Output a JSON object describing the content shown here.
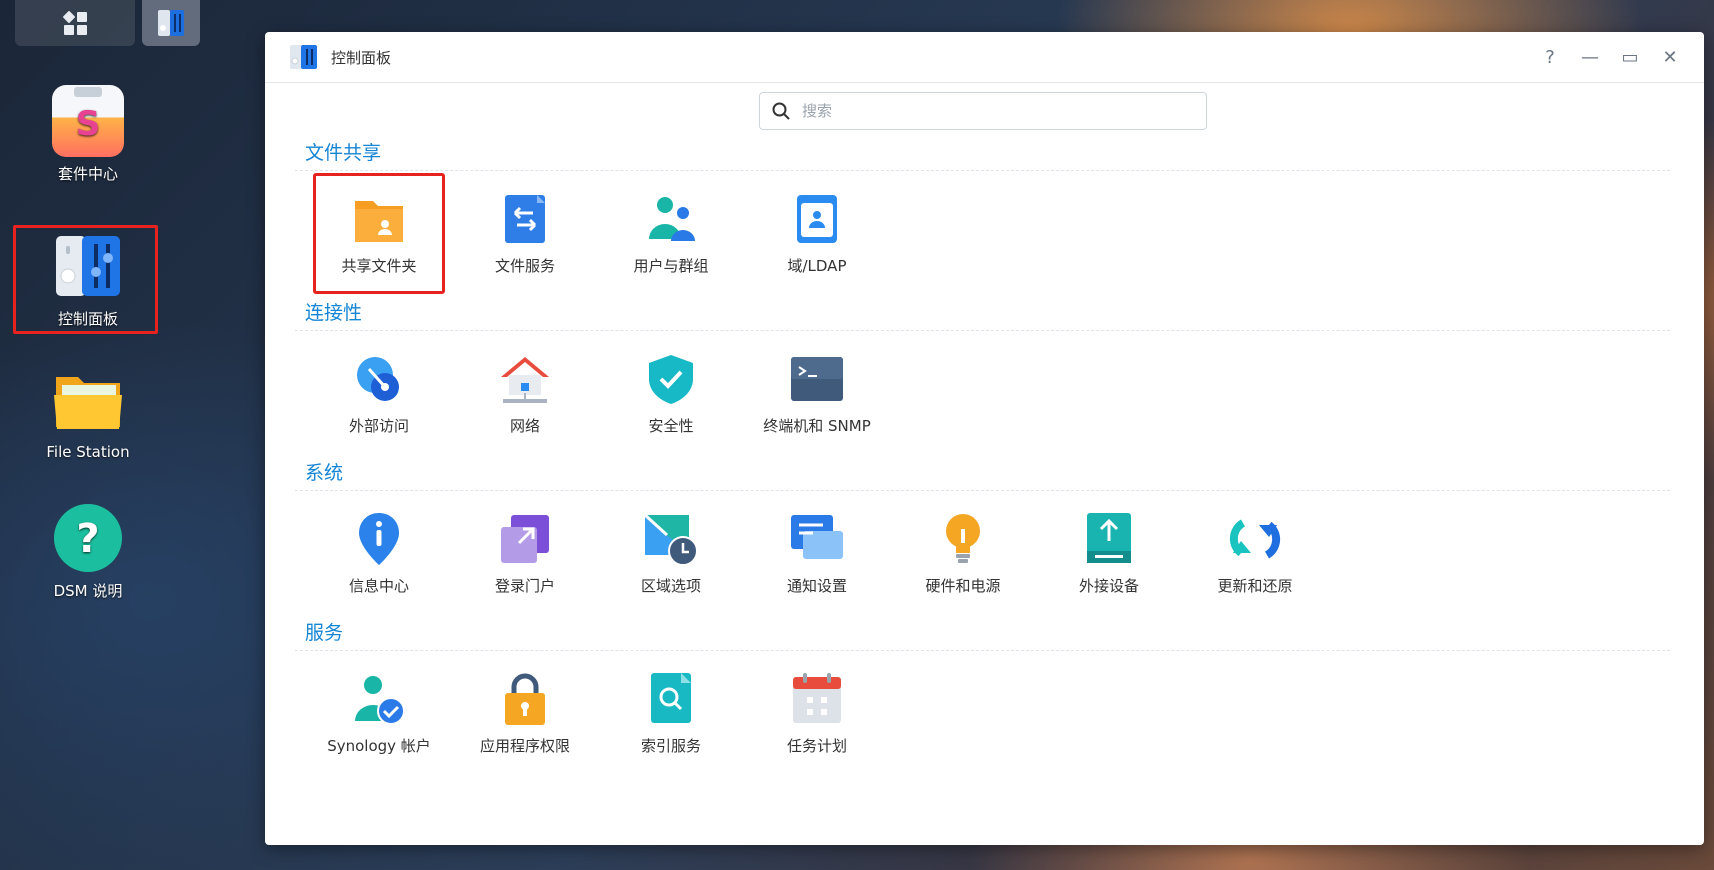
{
  "taskbar": {
    "grid_icon": "main-menu-grid-icon",
    "app_icon": "control-panel-taskbar-icon"
  },
  "desktop": {
    "items": [
      {
        "label": "套件中心",
        "icon": "package-center-icon"
      },
      {
        "label": "控制面板",
        "icon": "control-panel-icon"
      },
      {
        "label": "File Station",
        "icon": "folder-icon"
      },
      {
        "label": "DSM 说明",
        "icon": "help-icon"
      }
    ]
  },
  "window": {
    "title": "控制面板",
    "controls": {
      "help": "?",
      "minimize": "—",
      "maximize": "▭",
      "close": "✕"
    },
    "search": {
      "placeholder": "搜索",
      "value": ""
    },
    "sections": [
      {
        "title": "文件共享",
        "items": [
          "共享文件夹",
          "文件服务",
          "用户与群组",
          "域/LDAP"
        ]
      },
      {
        "title": "连接性",
        "items": [
          "外部访问",
          "网络",
          "安全性",
          "终端机和 SNMP"
        ]
      },
      {
        "title": "系统",
        "items": [
          "信息中心",
          "登录门户",
          "区域选项",
          "通知设置",
          "硬件和电源",
          "外接设备",
          "更新和还原"
        ]
      },
      {
        "title": "服务",
        "items": [
          "Synology 帐户",
          "应用程序权限",
          "索引服务",
          "任务计划"
        ]
      }
    ]
  },
  "colors": {
    "accent": "#1585d4",
    "highlight": "#e6231f"
  }
}
